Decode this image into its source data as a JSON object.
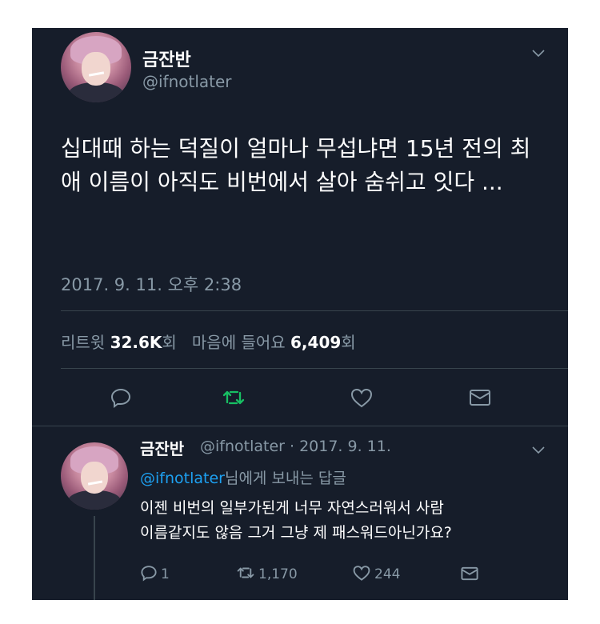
{
  "main_tweet": {
    "display_name": "금잔반",
    "handle": "@ifnotlater",
    "text": "십대때 하는 덕질이 얼마나 무섭냐면 15년 전의 최애 이름이 아직도 비번에서 살아 숨쉬고 잇다 ...",
    "timestamp": "2017. 9. 11. 오후 2:38",
    "retweets_label": "리트윗",
    "retweets_value": "32.6K",
    "likes_label": "마음에 들어요",
    "likes_value": "6,409",
    "count_suffix": "회"
  },
  "actions": {
    "reply_icon": "comment-icon",
    "retweet_icon": "retweet-icon",
    "like_icon": "heart-icon",
    "dm_icon": "envelope-icon",
    "retweet_color": "#17bf63"
  },
  "reply_tweet": {
    "display_name": "금잔반",
    "handle_and_date": "@ifnotlater · 2017. 9. 11.",
    "replying_to_handle": "@ifnotlater",
    "replying_to_suffix": "님에게 보내는 답글",
    "text_line1": "이젠 비번의 일부가된게 너무 자연스러워서 사람",
    "text_line2": "이름같지도 않음 그거 그냥 제 패스워드아닌가요?",
    "reply_count": "1",
    "retweet_count": "1,170",
    "like_count": "244"
  }
}
